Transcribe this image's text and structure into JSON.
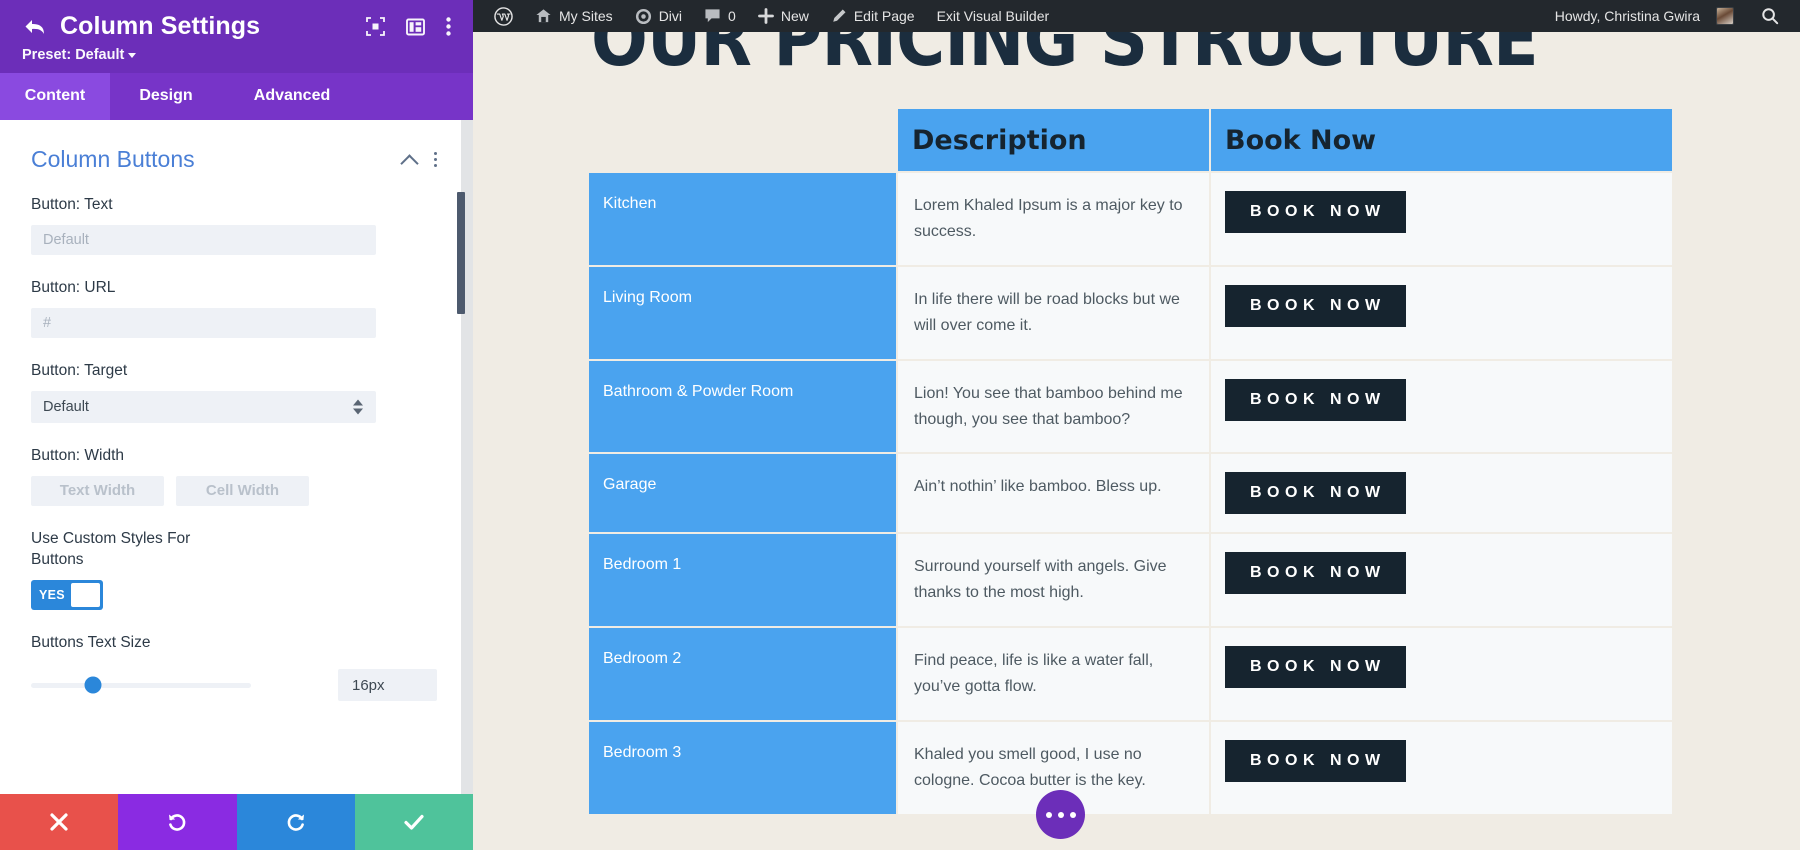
{
  "settings_panel": {
    "title": "Column Settings",
    "preset_label": "Preset: Default",
    "header_icons": [
      "focus-icon",
      "layout-icon",
      "more-options-icon"
    ],
    "back_icon": "back-arrow-icon",
    "tabs": [
      {
        "label": "Content",
        "active": true
      },
      {
        "label": "Design",
        "active": false
      },
      {
        "label": "Advanced",
        "active": false
      }
    ],
    "group": {
      "title": "Column Buttons",
      "collapse_icon": "chevron-up-icon",
      "menu_icon": "more-options-icon"
    },
    "fields": {
      "button_text": {
        "label": "Button: Text",
        "placeholder": "Default",
        "value": ""
      },
      "button_url": {
        "label": "Button: URL",
        "placeholder": "#",
        "value": ""
      },
      "button_target": {
        "label": "Button: Target",
        "value": "Default"
      },
      "button_width": {
        "label": "Button: Width",
        "options": [
          "Text Width",
          "Cell Width"
        ]
      },
      "custom_styles": {
        "label": "Use Custom Styles For Buttons",
        "toggle_state": "YES"
      },
      "buttons_text_size": {
        "label": "Buttons Text Size",
        "value": "16px",
        "slider_percent": 28
      }
    },
    "footer_buttons": [
      {
        "name": "cancel",
        "icon": "close-icon",
        "color": "#e8514b"
      },
      {
        "name": "undo",
        "icon": "undo-icon",
        "color": "#8a2be2"
      },
      {
        "name": "redo",
        "icon": "redo-icon",
        "color": "#2b87da"
      },
      {
        "name": "save",
        "icon": "check-icon",
        "color": "#4fc39b"
      }
    ]
  },
  "adminbar": {
    "items": [
      {
        "label": "",
        "icon": "wordpress-logo-icon"
      },
      {
        "label": "My Sites",
        "icon": "sites-icon"
      },
      {
        "label": "Divi",
        "icon": "divi-icon"
      },
      {
        "label": "0",
        "icon": "comment-icon"
      },
      {
        "label": "New",
        "icon": "plus-icon"
      },
      {
        "label": "Edit Page",
        "icon": "pencil-icon"
      },
      {
        "label": "Exit Visual Builder",
        "icon": ""
      }
    ],
    "howdy": "Howdy, Christina Gwira",
    "avatar": "user-avatar",
    "search_icon": "search-icon"
  },
  "page": {
    "heading": "OUR PRICING STRUCTURE",
    "fab_icon": "more-options-icon",
    "colors": {
      "background": "#f0ece4",
      "accent_blue": "#4aa3ef",
      "dark": "#16242f",
      "cell_bg": "#f7f9fa",
      "purple": "#6c2eb9"
    },
    "table": {
      "headers": [
        "",
        "Description",
        "Book Now"
      ],
      "rows": [
        {
          "room": "Kitchen",
          "description": "Lorem Khaled Ipsum is a major key to success.",
          "button": "BOOK NOW"
        },
        {
          "room": "Living Room",
          "description": "In life there will be road blocks but we will over come it.",
          "button": "BOOK NOW"
        },
        {
          "room": "Bathroom & Powder Room",
          "description": "Lion! You see that bamboo behind me though, you see that bamboo?",
          "button": "BOOK NOW"
        },
        {
          "room": "Garage",
          "description": "Ain’t nothin’ like bamboo. Bless up.",
          "button": "BOOK NOW"
        },
        {
          "room": "Bedroom 1",
          "description": "Surround yourself with angels. Give thanks to the most high.",
          "button": "BOOK NOW"
        },
        {
          "room": "Bedroom 2",
          "description": "Find peace, life is like a water fall, you’ve gotta flow.",
          "button": "BOOK NOW"
        },
        {
          "room": "Bedroom 3",
          "description": "Khaled you smell good, I use no cologne. Cocoa butter is the key.",
          "button": "BOOK NOW"
        }
      ]
    }
  }
}
